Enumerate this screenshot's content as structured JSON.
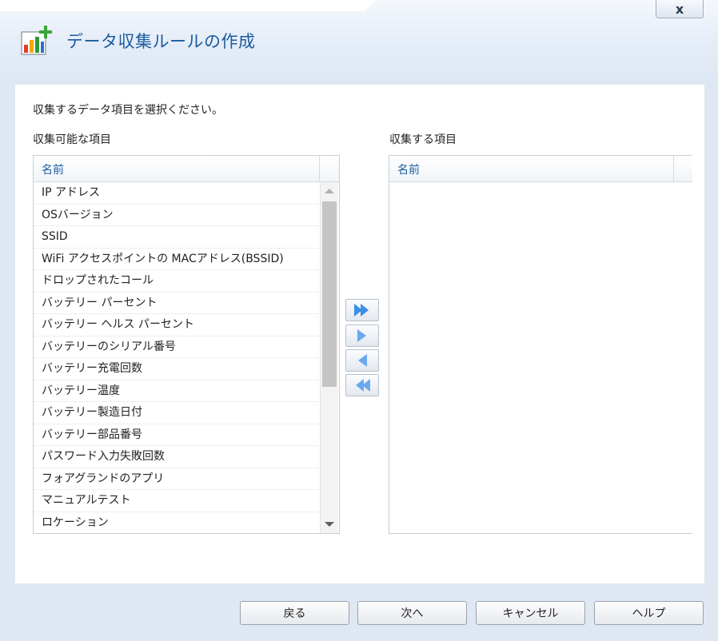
{
  "window": {
    "title": "データ収集ルールの作成",
    "close_label": "x"
  },
  "main": {
    "instruction": "収集するデータ項目を選択ください。",
    "available": {
      "label": "収集可能な項目",
      "column": "名前",
      "items": [
        "IP アドレス",
        "OSバージョン",
        "SSID",
        "WiFi アクセスポイントの MACアドレス(BSSID)",
        "ドロップされたコール",
        "バッテリー パーセント",
        "バッテリー ヘルス パーセント",
        "バッテリーのシリアル番号",
        "バッテリー充電回数",
        "バッテリー温度",
        "バッテリー製造日付",
        "バッテリー部品番号",
        "パスワード入力失敗回数",
        "フォアグランドのアプリ",
        "マニュアルテスト",
        "ロケーション"
      ]
    },
    "selected": {
      "label": "収集する項目",
      "column": "名前",
      "items": []
    }
  },
  "footer": {
    "back": "戻る",
    "next": "次へ",
    "cancel": "キャンセル",
    "help": "ヘルプ"
  },
  "colors": {
    "accent": "#1a5aa0",
    "arrow": "#3a8ee6"
  },
  "icons": {
    "app": "chart-add-icon",
    "close": "close-icon"
  }
}
